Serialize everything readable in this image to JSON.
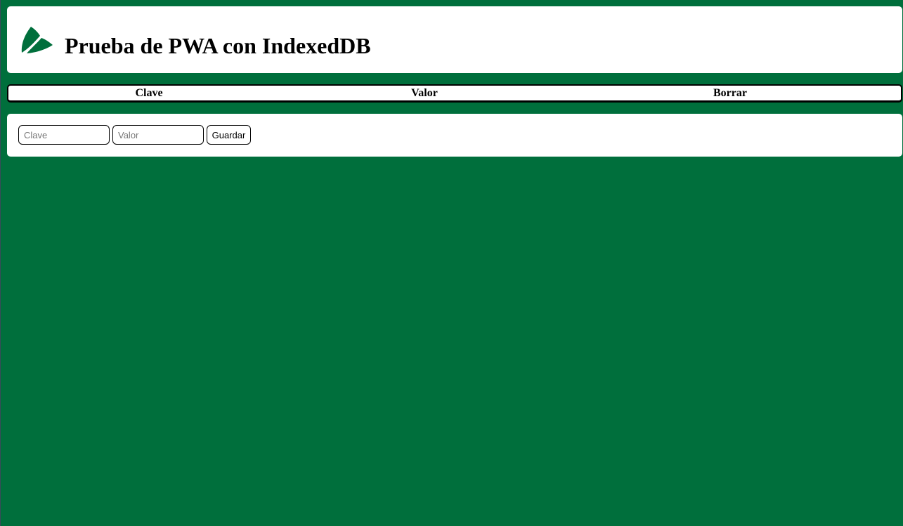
{
  "header": {
    "title": "Prueba de PWA con IndexedDB",
    "logo_icon": "leaf-logo-icon"
  },
  "table": {
    "columns": [
      "Clave",
      "Valor",
      "Borrar"
    ],
    "rows": []
  },
  "form": {
    "key_placeholder": "Clave",
    "key_value": "",
    "value_placeholder": "Valor",
    "value_value": "",
    "save_label": "Guardar"
  },
  "colors": {
    "background": "#006f3c",
    "card": "#ffffff",
    "logo": "#006f3c"
  }
}
